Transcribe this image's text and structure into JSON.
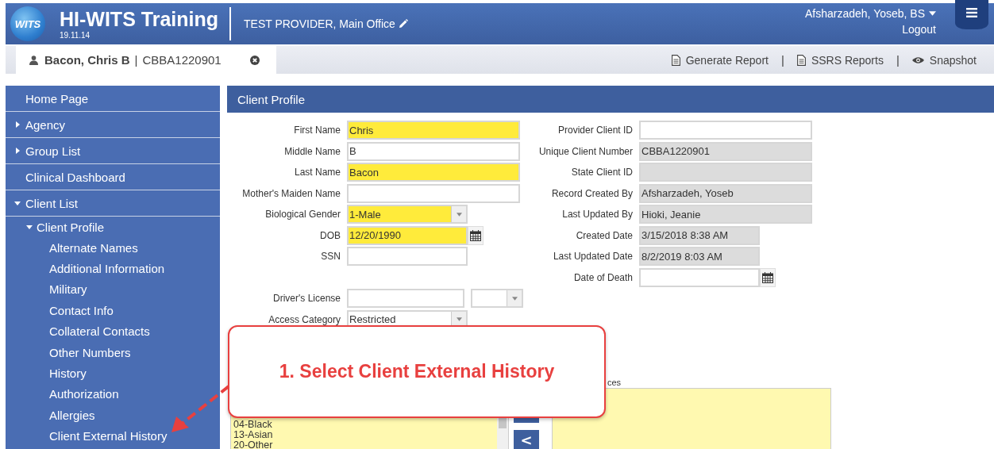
{
  "header": {
    "logo_text": "WITS",
    "app_title": "HI-WITS Training",
    "version": "19.11.14",
    "provider": "TEST PROVIDER, Main Office",
    "user": "Afsharzadeh, Yoseb, BS",
    "logout": "Logout"
  },
  "client_tab": {
    "name": "Bacon, Chris B",
    "separator": "|",
    "client_id": "CBBA1220901"
  },
  "toolbar": [
    {
      "label": "Generate Report",
      "kind": "report"
    },
    {
      "label": "SSRS Reports",
      "kind": "report"
    },
    {
      "label": "Snapshot",
      "kind": "view"
    }
  ],
  "toolbar_separator": "|",
  "sidebar": [
    {
      "label": "Home Page"
    },
    {
      "label": "Agency",
      "expanded": false
    },
    {
      "label": "Group List",
      "expanded": false
    },
    {
      "label": "Clinical Dashboard"
    },
    {
      "label": "Client List",
      "expanded": true,
      "children": [
        {
          "label": "Client Profile",
          "expanded": true,
          "children": [
            {
              "label": "Alternate Names"
            },
            {
              "label": "Additional Information"
            },
            {
              "label": "Military"
            },
            {
              "label": "Contact Info"
            },
            {
              "label": "Collateral Contacts"
            },
            {
              "label": "Other Numbers"
            },
            {
              "label": "History"
            },
            {
              "label": "Authorization"
            },
            {
              "label": "Allergies"
            },
            {
              "label": "Client External History"
            }
          ]
        }
      ]
    }
  ],
  "panel_title": "Client Profile",
  "identity_fields": [
    {
      "label": "First Name",
      "value": "Chris",
      "kind": "text",
      "required": true,
      "readonly": false
    },
    {
      "label": "Middle Name",
      "value": "B",
      "kind": "text",
      "required": false,
      "readonly": false
    },
    {
      "label": "Last Name",
      "value": "Bacon",
      "kind": "text",
      "required": true,
      "readonly": false
    },
    {
      "label": "Mother's Maiden Name",
      "kind": "text",
      "required": false,
      "readonly": false
    },
    {
      "label": "Biological Gender",
      "value": "1-Male",
      "kind": "select",
      "required": true,
      "readonly": false
    },
    {
      "label": "DOB",
      "value": "12/20/1990",
      "kind": "date",
      "required": true,
      "readonly": false
    },
    {
      "label": "SSN",
      "kind": "short-text",
      "required": false,
      "readonly": false
    }
  ],
  "other_fields": [
    {
      "label": "Driver's License",
      "kind": "license",
      "required": false,
      "readonly": false
    },
    {
      "label": "Access Category",
      "value": "Restricted",
      "kind": "select",
      "required": false,
      "readonly": false
    }
  ],
  "record_fields": [
    {
      "label": "Provider Client ID",
      "kind": "text",
      "required": false,
      "readonly": false
    },
    {
      "label": "Unique Client Number",
      "value": "CBBA1220901",
      "kind": "text",
      "required": false,
      "readonly": true
    },
    {
      "label": "State Client ID",
      "kind": "text",
      "required": false,
      "readonly": true
    },
    {
      "label": "Record Created By",
      "value": "Afsharzadeh, Yoseb",
      "kind": "text",
      "required": false,
      "readonly": true
    },
    {
      "label": "Last Updated By",
      "value": "Hioki, Jeanie",
      "kind": "text",
      "required": false,
      "readonly": true
    },
    {
      "label": "Created Date",
      "value": "3/15/2018 8:38 AM",
      "kind": "short-text",
      "required": false,
      "readonly": true
    },
    {
      "label": "Last Updated Date",
      "value": "8/2/2019 8:03 AM",
      "kind": "short-text",
      "required": false,
      "readonly": true
    },
    {
      "label": "Date of Death",
      "kind": "date",
      "required": false,
      "readonly": false
    }
  ],
  "available_list": {
    "items": [
      "04-Black",
      "13-Asian",
      "20-Other"
    ]
  },
  "move_left_button": "<",
  "selected_list": {
    "label": "ces"
  },
  "callout": {
    "text": "1. Select Client External History"
  }
}
